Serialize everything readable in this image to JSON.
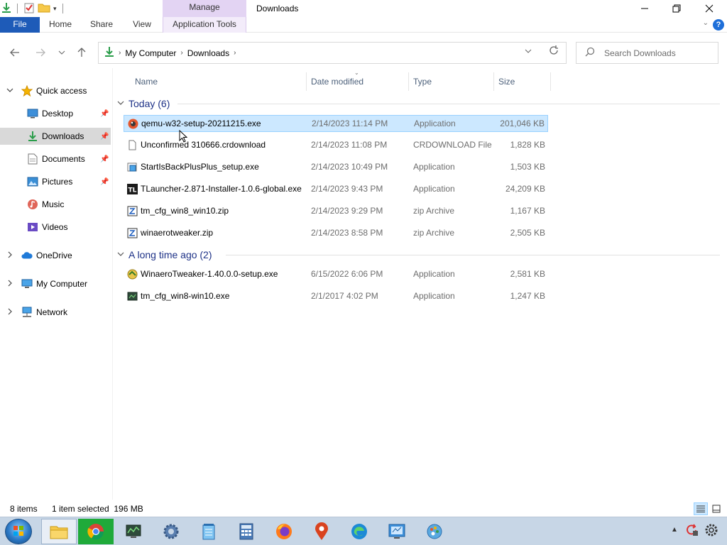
{
  "title_bar": {
    "context_tab": "Manage",
    "window_title": "Downloads",
    "minimize_label": "—",
    "maximize_label": "❐",
    "close_label": "✕"
  },
  "ribbon": {
    "tabs": [
      "File",
      "Home",
      "Share",
      "View",
      "Application Tools"
    ],
    "help_label": "?"
  },
  "address": {
    "breadcrumbs": [
      "My Computer",
      "Downloads"
    ]
  },
  "search": {
    "placeholder": "Search Downloads"
  },
  "nav_pane": {
    "quick_access": "Quick access",
    "items": [
      "Desktop",
      "Downloads",
      "Documents",
      "Pictures",
      "Music",
      "Videos"
    ],
    "onedrive": "OneDrive",
    "my_computer": "My Computer",
    "network": "Network",
    "selected": "Downloads"
  },
  "columns": [
    "Name",
    "Date modified",
    "Type",
    "Size"
  ],
  "groups": [
    {
      "label": "Today (6)",
      "files": [
        {
          "name": "qemu-w32-setup-20211215.exe",
          "date": "2/14/2023 11:14 PM",
          "type": "Application",
          "size": "201,046 KB",
          "icon": "qemu-icon",
          "selected": true
        },
        {
          "name": "Unconfirmed 310666.crdownload",
          "date": "2/14/2023 11:08 PM",
          "type": "CRDOWNLOAD File",
          "size": "1,828 KB",
          "icon": "blank-file-icon"
        },
        {
          "name": "StartIsBackPlusPlus_setup.exe",
          "date": "2/14/2023 10:49 PM",
          "type": "Application",
          "size": "1,503 KB",
          "icon": "setup-icon"
        },
        {
          "name": "TLauncher-2.871-Installer-1.0.6-global.exe",
          "date": "2/14/2023 9:43 PM",
          "type": "Application",
          "size": "24,209 KB",
          "icon": "tlauncher-icon"
        },
        {
          "name": "tm_cfg_win8_win10.zip",
          "date": "2/14/2023 9:29 PM",
          "type": "zip Archive",
          "size": "1,167 KB",
          "icon": "zip-icon"
        },
        {
          "name": "winaerotweaker.zip",
          "date": "2/14/2023 8:58 PM",
          "type": "zip Archive",
          "size": "2,505 KB",
          "icon": "zip-icon"
        }
      ]
    },
    {
      "label": "A long time ago (2)",
      "files": [
        {
          "name": "WinaeroTweaker-1.40.0.0-setup.exe",
          "date": "6/15/2022 6:06 PM",
          "type": "Application",
          "size": "2,581 KB",
          "icon": "winaero-icon"
        },
        {
          "name": "tm_cfg_win8-win10.exe",
          "date": "2/1/2017 4:02 PM",
          "type": "Application",
          "size": "1,247 KB",
          "icon": "tm-icon"
        }
      ]
    }
  ],
  "status": {
    "item_count": "8 items",
    "selection": "1 item selected  196 MB"
  },
  "colors": {
    "file_tab": "#1e5bb8",
    "manage_tab": "#e3d4f3",
    "selection_bg": "#cce8ff",
    "selection_border": "#99d1ff",
    "group_header": "#1e3287",
    "taskbar": "#c7d6e6"
  },
  "taskbar": {
    "items": [
      "start-orb",
      "file-explorer-icon",
      "chrome-icon",
      "task-manager-icon",
      "settings-gear-icon",
      "notepad-icon",
      "calculator-icon",
      "firefox-icon",
      "maps-pin-icon",
      "edge-icon",
      "control-panel-icon",
      "paint-icon"
    ],
    "tray": [
      "tray-expand-icon",
      "tray-refresh-icon",
      "tray-settings-icon"
    ]
  }
}
